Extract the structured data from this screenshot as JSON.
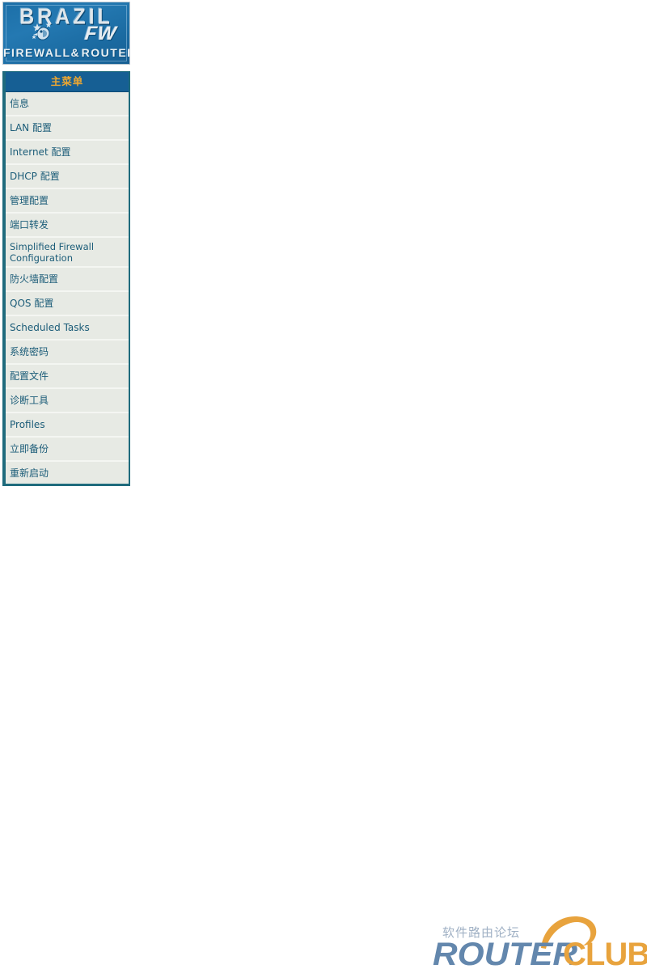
{
  "logo": {
    "brand_top": "BRAZIL",
    "brand_fw": "FW",
    "brand_bottom_left": "FIREWALL",
    "brand_bottom_amp": "&",
    "brand_bottom_right": "ROUTER",
    "emblem_icon": "parrot-star-emblem-icon",
    "background_color": "#1c6fa8",
    "text_color": "#dfe6ea"
  },
  "menu": {
    "header": "主菜单",
    "header_bg": "#165f94",
    "header_text_color": "#f0a830",
    "item_bg": "#e7eae4",
    "item_text_color": "#1b5c78",
    "border_color": "#1f6b7d",
    "items": [
      {
        "label": "信息",
        "two_line": false
      },
      {
        "label": "LAN 配置",
        "two_line": false
      },
      {
        "label": "Internet 配置",
        "two_line": false
      },
      {
        "label": "DHCP 配置",
        "two_line": false
      },
      {
        "label": "管理配置",
        "two_line": false
      },
      {
        "label": "端口转发",
        "two_line": false
      },
      {
        "label": "Simplified Firewall\nConfiguration",
        "two_line": true
      },
      {
        "label": "防火墙配置",
        "two_line": false
      },
      {
        "label": "QOS 配置",
        "two_line": false
      },
      {
        "label": "Scheduled Tasks",
        "two_line": false
      },
      {
        "label": "系统密码",
        "two_line": false
      },
      {
        "label": "配置文件",
        "two_line": false
      },
      {
        "label": "诊断工具",
        "two_line": false
      },
      {
        "label": "Profiles",
        "two_line": false
      },
      {
        "label": "立即备份",
        "two_line": false
      },
      {
        "label": "重新启动",
        "two_line": false
      }
    ]
  },
  "watermark": {
    "chinese": "软件路由论坛",
    "router": "ROUTER",
    "club": "CLUB",
    "swoosh_icon": "swoosh-arc-icon",
    "router_color": "#6387ad",
    "club_color": "#e8a33d",
    "chinese_color": "#9fb0c4"
  }
}
